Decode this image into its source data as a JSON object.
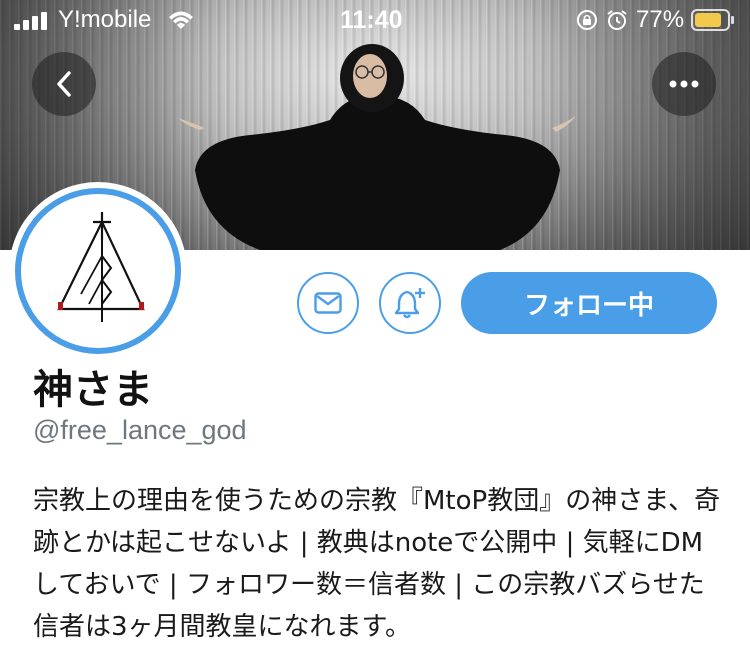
{
  "status_bar": {
    "carrier": "Y!mobile",
    "time": "11:40",
    "battery_percent": "77%",
    "icons": [
      "signal-icon",
      "wifi-icon",
      "rotation-lock-icon",
      "alarm-icon",
      "battery-icon"
    ]
  },
  "header": {
    "back_icon": "chevron-left-icon",
    "more_icon": "more-horizontal-icon"
  },
  "actions": {
    "message_icon": "mail-icon",
    "notify_icon": "bell-plus-icon",
    "follow_label": "フォロー中"
  },
  "profile": {
    "display_name": "神さま",
    "handle": "@free_lance_god",
    "bio": "宗教上の理由を使うための宗教『MtoP教団』の神さま、奇跡とかは起こせないよ | 教典はnoteで公開中 | 気軽にDMしておいで | フォロワー数＝信者数 | この宗教バズらせた信者は3ヶ月間教皇になれます。"
  },
  "colors": {
    "accent": "#4a9ee8",
    "text": "#111111",
    "muted": "#6e7780"
  }
}
